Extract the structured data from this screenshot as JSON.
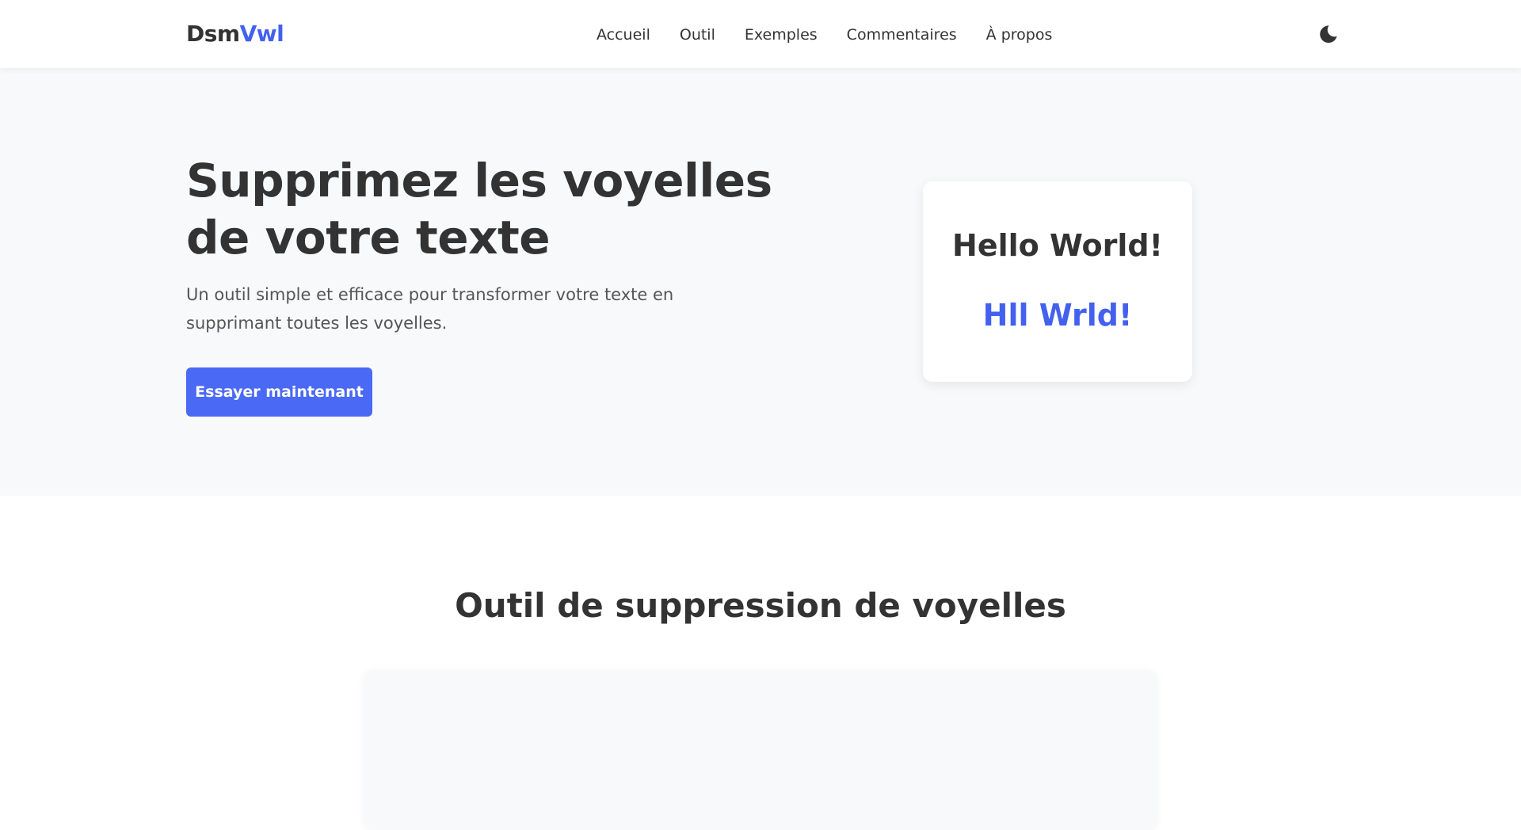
{
  "header": {
    "logo_part1": "Dsm",
    "logo_part2": "Vwl",
    "nav": [
      "Accueil",
      "Outil",
      "Exemples",
      "Commentaires",
      "À propos"
    ],
    "theme_icon": "moon-icon"
  },
  "hero": {
    "title": "Supprimez les voyelles de votre texte",
    "subtitle": "Un outil simple et efficace pour transformer votre texte en supprimant toutes les voyelles.",
    "cta_label": "Essayer maintenant",
    "demo_original": "Hello World!",
    "demo_result": "Hll Wrld!"
  },
  "tool": {
    "title": "Outil de suppression de voyelles"
  },
  "colors": {
    "accent": "#4361ee",
    "button": "#4a69f5",
    "text": "#333333",
    "hero_bg": "#f8f9fa"
  }
}
